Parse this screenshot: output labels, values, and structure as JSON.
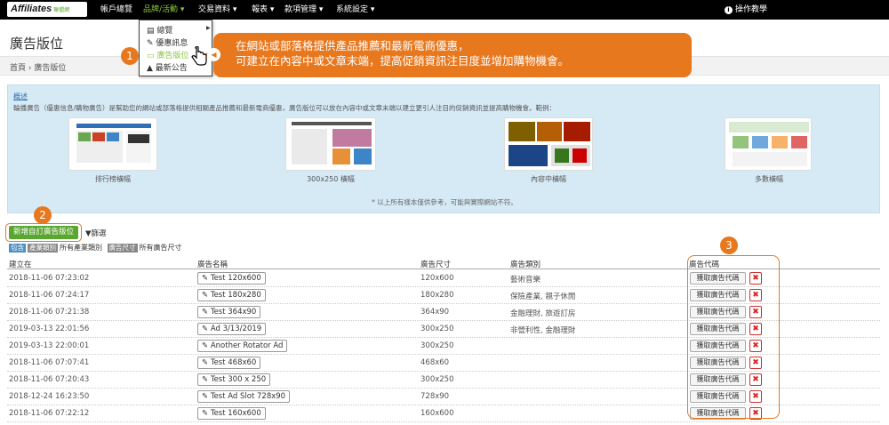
{
  "topbar": {
    "logo": "Affiliates",
    "logo_sub": "聯盟網",
    "nav": [
      "帳戶總覽",
      "品牌/活動 ▾",
      "交易資料 ▾",
      "報表 ▾",
      "款項管理 ▾",
      "系統設定 ▾"
    ],
    "help": "操作教學"
  },
  "dropdown": {
    "items": [
      "總覽",
      "優惠訊息",
      "廣告版位",
      "最新公告"
    ]
  },
  "page": {
    "title": "廣告版位",
    "breadcrumb": "首頁 › 廣告版位"
  },
  "callout": {
    "line1": "在網站或部落格提供產品推薦和最新電商優惠，",
    "line2": "可建立在內容中或文章末端，提高促銷資訊注目度並增加購物機會。"
  },
  "badges": [
    "1",
    "2",
    "3"
  ],
  "overview": {
    "title": "概述",
    "description": "輪播廣告（優惠信息/購物廣告）是幫助您的網站或部落格提供相關產品推薦和最新電商優惠，廣告版位可以放在內容中或文章末端以建立更引人注目的促銷資訊並提高購物機會。範例：",
    "samples": [
      "排行榜橫幅",
      "300x250 橫幅",
      "內容中橫幅",
      "多數橫幅"
    ],
    "note": "* 以上所有樣本僅供參考，可能與實際網站不符。"
  },
  "toolbar": {
    "add_button": "新增自訂廣告版位",
    "filter_button": "篩選",
    "filters": [
      {
        "chip": "包含",
        "label": ""
      },
      {
        "chip": "產業類別",
        "label": "所有產業類別"
      },
      {
        "chip": "廣告尺寸",
        "label": "所有廣告尺寸"
      }
    ]
  },
  "table": {
    "headers": [
      "建立在",
      "廣告名稱",
      "廣告尺寸",
      "廣告類別",
      "廣告代碼"
    ],
    "code_button": "獲取廣告代碼",
    "delete_symbol": "✖",
    "rows": [
      {
        "created": "2018-11-06 07:23:02",
        "name": "Test 120x600",
        "size": "120x600",
        "category": "藝術音樂"
      },
      {
        "created": "2018-11-06 07:24:17",
        "name": "Test 180x280",
        "size": "180x280",
        "category": "保險產業, 親子休閒"
      },
      {
        "created": "2018-11-06 07:21:38",
        "name": "Test 364x90",
        "size": "364x90",
        "category": "金融理財, 旅遊訂房"
      },
      {
        "created": "2019-03-13 22:01:56",
        "name": "Ad 3/13/2019",
        "size": "300x250",
        "category": "非營利性, 金融理財"
      },
      {
        "created": "2019-03-13 22:00:01",
        "name": "Another Rotator Ad",
        "size": "300x250",
        "category": ""
      },
      {
        "created": "2018-11-06 07:07:41",
        "name": "Test 468x60",
        "size": "468x60",
        "category": ""
      },
      {
        "created": "2018-11-06 07:20:43",
        "name": "Test 300 x 250",
        "size": "300x250",
        "category": ""
      },
      {
        "created": "2018-12-24 16:23:50",
        "name": "Test Ad Slot 728x90",
        "size": "728x90",
        "category": ""
      },
      {
        "created": "2018-11-06 07:22:12",
        "name": "Test 160x600",
        "size": "160x600",
        "category": ""
      }
    ]
  },
  "colors": {
    "accent_orange": "#e8781e",
    "brand_green": "#5aa630",
    "nav_active": "#8dc63f",
    "panel_blue": "#d6eaf5",
    "delete_red": "#d22222"
  }
}
